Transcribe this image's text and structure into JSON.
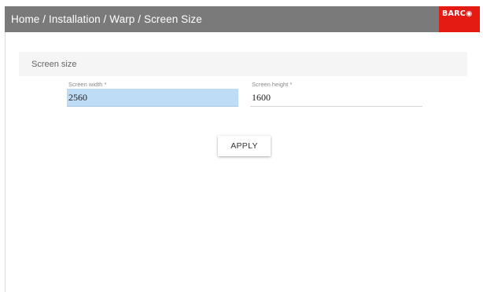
{
  "header": {
    "breadcrumb": "Home / Installation / Warp / Screen Size",
    "logo_text": "BARC◉",
    "bar_color": "#7a7a7a",
    "logo_color": "#e41b13"
  },
  "section": {
    "title": "Screen size"
  },
  "fields": {
    "width": {
      "label": "Screen width *",
      "value": "2560",
      "highlight_color": "#bfdcf7"
    },
    "height": {
      "label": "Screen height *",
      "value": "1600"
    }
  },
  "actions": {
    "apply_label": "APPLY"
  }
}
